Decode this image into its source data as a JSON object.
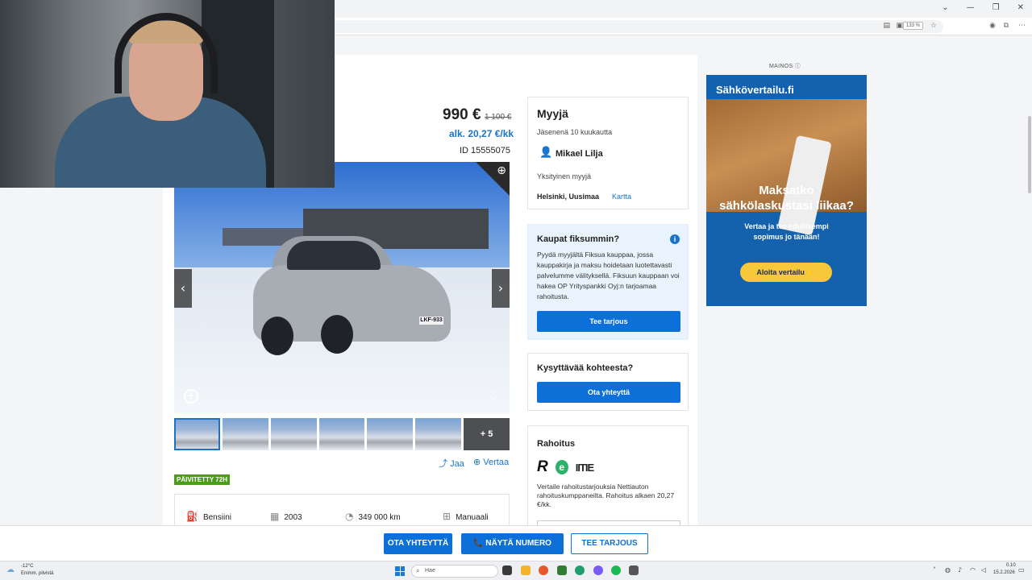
{
  "browser": {
    "zoom": "133 %",
    "window_controls": [
      "⌄",
      "—",
      "❐",
      "✕"
    ]
  },
  "listing": {
    "price": "990 €",
    "old_price": "1 100 €",
    "monthly": "alk. 20,27 €/kk",
    "id": "ID 15555075",
    "plate": "LKF-933",
    "photo_more": "+ 5",
    "share_label": "Jaa",
    "compare_label": "Vertaa",
    "updated_badge": "PÄIVITETTY 72H",
    "specs": [
      {
        "icon": "fuel-icon",
        "glyph": "⛽",
        "value": "Bensiini"
      },
      {
        "icon": "calendar-icon",
        "glyph": "▦",
        "value": "2003"
      },
      {
        "icon": "speedometer-icon",
        "glyph": "◔",
        "value": "349 000 km"
      },
      {
        "icon": "gearbox-icon",
        "glyph": "⊞",
        "value": "Manuaali"
      }
    ]
  },
  "seller": {
    "title": "Myyjä",
    "member_since": "Jäsenenä 10 kuukautta",
    "name": "Mikael Lilja",
    "type": "Yksityinen myyjä",
    "location": "Helsinki, Uusimaa",
    "map_link": "Kartta"
  },
  "deal": {
    "title": "Kaupat fiksummin?",
    "body": "Pyydä myyjältä Fiksua kauppaa, jossa kauppakirja ja maksu hoidetaan luotettavasti palvelumme välityksellä. Fiksuun kauppaan voi hakea OP Yrityspankki Oyj:n tarjoamaa rahoitusta.",
    "button": "Tee tarjous"
  },
  "ask": {
    "title": "Kysyttävää kohteesta?",
    "button": "Ota yhteyttä"
  },
  "finance": {
    "title": "Rahoitus",
    "logos": [
      "R",
      "e",
      "IITIE"
    ],
    "body": "Vertaile rahoitustarjouksia Nettiauton rahoituskumppaneilta. Rahoitus alkaen 20,27 €/kk."
  },
  "ad": {
    "label": "MAINOS ⓘ",
    "brand": "Sähkövertailu.fi",
    "headline_1": "Maksatko",
    "headline_2": "sähkölaskustasi liikaa?",
    "sub_1": "Vertaa ja tee edullisempi",
    "sub_2": "sopimus jo tänään!",
    "cta": "Aloita vertailu ⚡"
  },
  "sticky": {
    "contact": "OTA YHTEYTTÄ",
    "show_number": "📞 NÄYTÄ NUMERO",
    "offer": "TEE TARJOUS"
  },
  "taskbar": {
    "temp": "-12°C",
    "weather": "Enimm. pilvistä",
    "search_placeholder": "Hae",
    "time": "0.10",
    "date": "15.2.2026"
  },
  "colors": {
    "accent": "#0d6fd8",
    "link": "#1a73c8",
    "badge_green": "#4d9b1c",
    "ad_blue": "#1461ad"
  }
}
